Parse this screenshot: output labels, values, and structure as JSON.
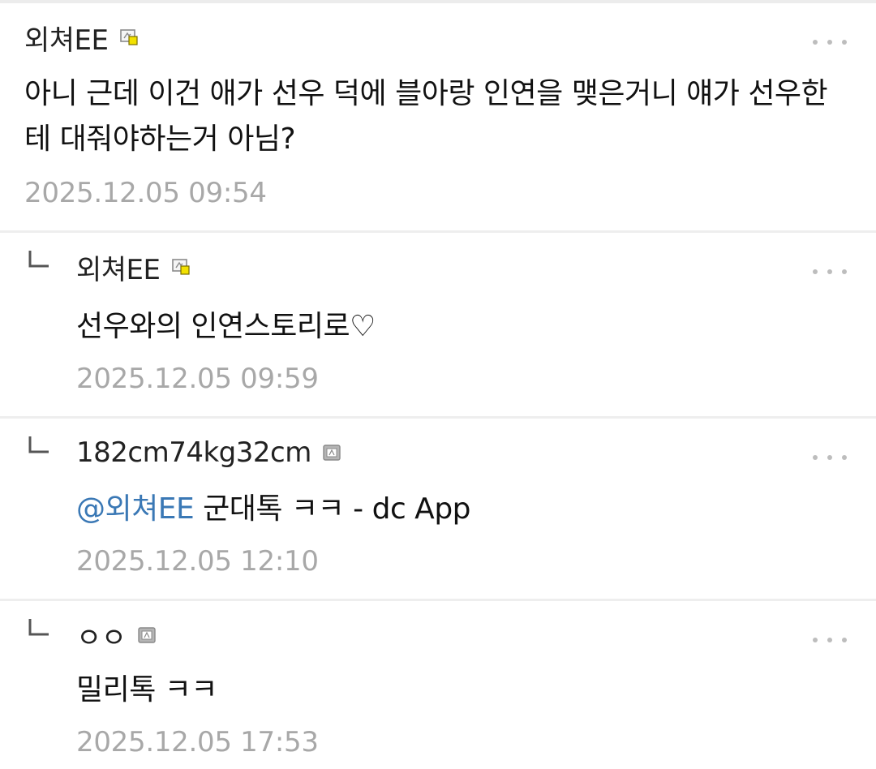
{
  "comments": [
    {
      "author": "외쳐EE",
      "badge": "gallog-badge-yellow",
      "text": "아니 근데 이건 애가 선우 덕에 블아랑 인연을 맺은거니 얘가 선우한테 대줘야하는거 아님?",
      "date": "2025.12.05 09:54",
      "is_reply": false
    },
    {
      "author": "외쳐EE",
      "badge": "gallog-badge-yellow",
      "text": "선우와의 인연스토리로♡",
      "date": "2025.12.05 09:59",
      "is_reply": true
    },
    {
      "author": "182cm74kg32cm",
      "badge": "gallog-badge-gray",
      "mention": "@외쳐EE",
      "text": " 군대톡 ㅋㅋ - dc App",
      "date": "2025.12.05 12:10",
      "is_reply": true
    },
    {
      "author": "ㅇㅇ",
      "badge": "gallog-badge-gray",
      "text": "밀리톡 ㅋㅋ",
      "date": "2025.12.05 17:53",
      "is_reply": true
    }
  ],
  "colors": {
    "mention": "#3a78b5",
    "date": "#a8a8a8",
    "separator": "#eeeeee",
    "badge_yellow": "#f2e100",
    "badge_gray": "#9e9e9e"
  },
  "icons": {
    "more": "more-dots-icon",
    "reply": "reply-arrow-icon"
  }
}
